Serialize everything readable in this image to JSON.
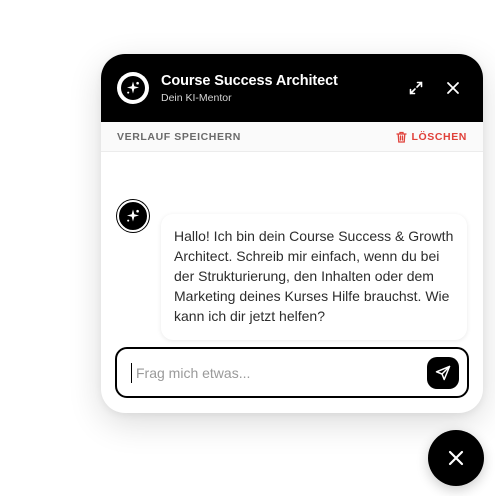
{
  "header": {
    "title": "Course Success Architect",
    "subtitle": "Dein KI-Mentor",
    "avatar_icon": "ai-sparkle-logo-icon",
    "expand_icon": "expand-icon",
    "close_icon": "close-icon"
  },
  "toolbar": {
    "save_label": "VERLAUF SPEICHERN",
    "delete_label": "LÖSCHEN",
    "delete_icon": "trash-icon"
  },
  "messages": [
    {
      "role": "assistant",
      "avatar_icon": "ai-sparkle-logo-icon",
      "text": "Hallo! Ich bin dein Course Success & Growth Architect. Schreib mir einfach, wenn du bei der Strukturierung, den Inhalten oder dem Marketing deines Kurses Hilfe brauchst. Wie kann ich dir jetzt helfen?"
    }
  ],
  "input": {
    "placeholder": "Frag mich etwas...",
    "value": "",
    "send_icon": "send-icon"
  },
  "fab": {
    "icon": "close-icon"
  },
  "colors": {
    "header_bg": "#000000",
    "accent": "#000000",
    "danger": "#e0413a"
  }
}
